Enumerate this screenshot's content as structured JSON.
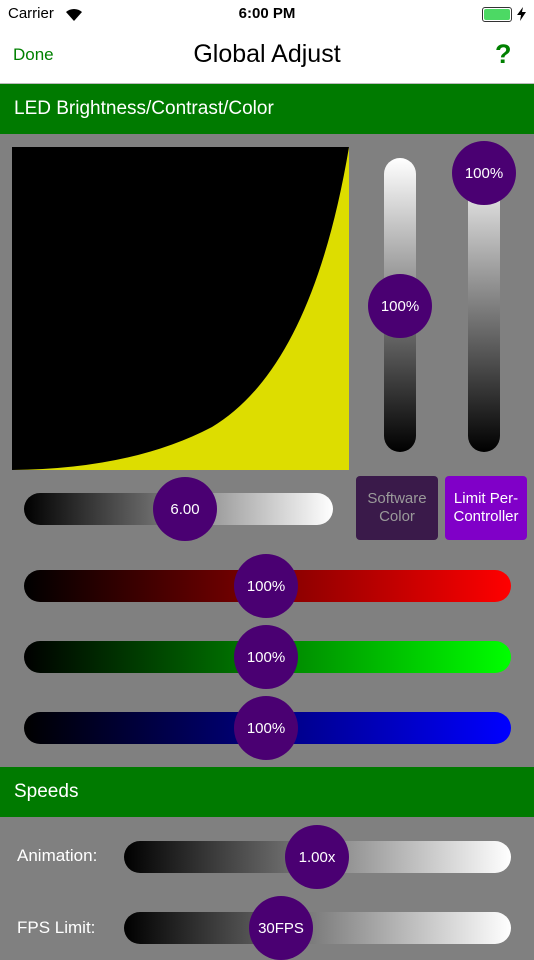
{
  "status": {
    "carrier": "Carrier",
    "time": "6:00 PM"
  },
  "nav": {
    "done": "Done",
    "title": "Global Adjust",
    "help": "?"
  },
  "sections": {
    "led": "LED Brightness/Contrast/Color",
    "speeds": "Speeds"
  },
  "sliders": {
    "vertical_left": {
      "label": "100%",
      "value": 1.0
    },
    "vertical_right": {
      "label": "100%",
      "value": 1.0
    },
    "gamma": {
      "label": "6.00"
    },
    "red": {
      "label": "100%",
      "color": "#FF0000"
    },
    "green": {
      "label": "100%",
      "color": "#00FF00"
    },
    "blue": {
      "label": "100%",
      "color": "#0000FF"
    }
  },
  "buttons": {
    "software_color": "Software Color",
    "limit_per_controller": "Limit Per-Controller"
  },
  "speeds": {
    "animation": {
      "label": "Animation:",
      "value": "1.00x"
    },
    "fps": {
      "label": "FPS Limit:",
      "value": "30FPS"
    }
  },
  "colors": {
    "accent": "#007A00",
    "knob": "#4A0072",
    "curve": "#DDDD00"
  }
}
